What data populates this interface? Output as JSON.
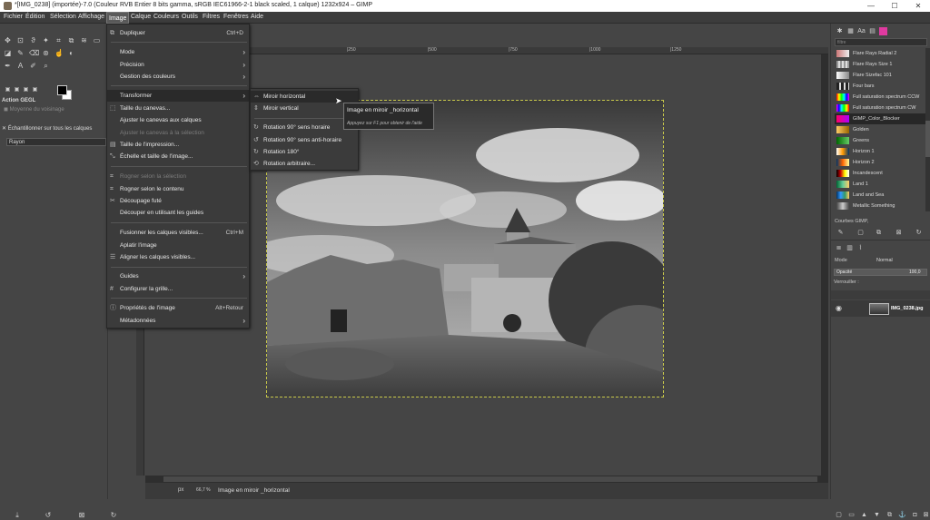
{
  "window": {
    "title": "*[IMG_0238] (importée)-7.0 (Couleur RVB Entier 8 bits gamma, sRGB IEC61966-2-1 black scaled, 1 calque) 1232x924 – GIMP",
    "min": "—",
    "max": "☐",
    "close": "✕"
  },
  "menubar": [
    "Fichier",
    "Édition",
    "Sélection",
    "Affichage",
    "Image",
    "Calque",
    "Couleurs",
    "Outils",
    "Filtres",
    "Fenêtres",
    "Aide"
  ],
  "left_panel": {
    "panel_title": "Action GEGL",
    "opt1": "Moyenne du voisinage",
    "field_label": "Rayon",
    "opt2": "Échantillonner sur tous les calques"
  },
  "image_menu": [
    {
      "label": "Dupliquer",
      "acc": "Ctrl+D",
      "icon": "⧉"
    },
    {
      "label": "Mode",
      "arrow": true
    },
    {
      "label": "Précision",
      "arrow": true
    },
    {
      "label": "Gestion des couleurs",
      "arrow": true
    },
    {
      "label": "Transformer",
      "arrow": true,
      "highlight": true
    },
    {
      "label": "Taille du canevas...",
      "icon": "⬚"
    },
    {
      "label": "Ajuster le canevas aux calques"
    },
    {
      "label": "Ajuster le canevas à la sélection",
      "disabled": true
    },
    {
      "label": "Taille de l'impression...",
      "icon": "▤"
    },
    {
      "label": "Échelle et taille de l'image...",
      "icon": "⤡"
    },
    {
      "label": "Rogner selon la sélection",
      "disabled": true,
      "icon": "⌗"
    },
    {
      "label": "Rogner selon le contenu",
      "icon": "⌗"
    },
    {
      "label": "Découpage futé",
      "icon": "✂"
    },
    {
      "label": "Découper en utilisant les guides"
    },
    {
      "label": "Fusionner les calques visibles...",
      "acc": "Ctrl+M"
    },
    {
      "label": "Aplatir l'image"
    },
    {
      "label": "Aligner les calques visibles...",
      "icon": "☰"
    },
    {
      "label": "Guides",
      "arrow": true
    },
    {
      "label": "Configurer la grille...",
      "icon": "#"
    },
    {
      "label": "Propriétés de l'image",
      "acc": "Alt+Retour",
      "icon": "ⓘ"
    },
    {
      "label": "Métadonnées",
      "arrow": true
    }
  ],
  "transform_menu": [
    {
      "label": "Miroir horizontal",
      "icon": "⇔",
      "highlight": true
    },
    {
      "label": "Miroir vertical",
      "icon": "⇕"
    },
    {
      "label": "Rotation 90° sens horaire",
      "icon": "↻"
    },
    {
      "label": "Rotation 90° sens anti-horaire",
      "icon": "↺"
    },
    {
      "label": "Rotation 180°",
      "icon": "↻"
    },
    {
      "label": "Rotation arbitraire...",
      "icon": "⟲"
    }
  ],
  "tooltip": {
    "title": "Image en miroir _horizontal",
    "hint": "Appuyez sur F1 pour obtenir de l'aide"
  },
  "ruler_ticks": [
    "|250",
    "|500",
    "|750",
    "|1000",
    "|1250"
  ],
  "status": {
    "unit": "px",
    "zoom": "66,7 %",
    "message": "Image en miroir _horizontal"
  },
  "right_panel": {
    "filter_placeholder": "filtre",
    "gradients": [
      {
        "name": "Flare Rays Radial 2",
        "color": "#c77"
      },
      {
        "name": "Flare Rays Size 1",
        "color": "#999"
      },
      {
        "name": "Flare Sizefac 101",
        "color": "#aaa"
      },
      {
        "name": "Four bars",
        "color": "#777"
      },
      {
        "name": "Full saturation spectrum CCW",
        "color": "#e4a"
      },
      {
        "name": "Full saturation spectrum CW",
        "color": "#4ae"
      },
      {
        "name": "GIMP_Color_Blocker",
        "color": "#d0a",
        "selected": true
      },
      {
        "name": "Golden",
        "color": "#c90"
      },
      {
        "name": "Greens",
        "color": "#3a3"
      },
      {
        "name": "Horizon 1",
        "color": "#e90"
      },
      {
        "name": "Horizon 2",
        "color": "#c60"
      },
      {
        "name": "Incandescent",
        "color": "#b20"
      },
      {
        "name": "Land 1",
        "color": "#296"
      },
      {
        "name": "Land and Sea",
        "color": "#26a"
      },
      {
        "name": "Metallic Something",
        "color": "#888"
      }
    ],
    "curves_label": "Courbes GIMP,",
    "mode_label": "Mode",
    "mode_value": "Normal",
    "opacity_label": "Opacité",
    "opacity_value": "100,0",
    "lock_label": "Verrouiller :",
    "layer_name": "IMG_0238.jpg"
  }
}
